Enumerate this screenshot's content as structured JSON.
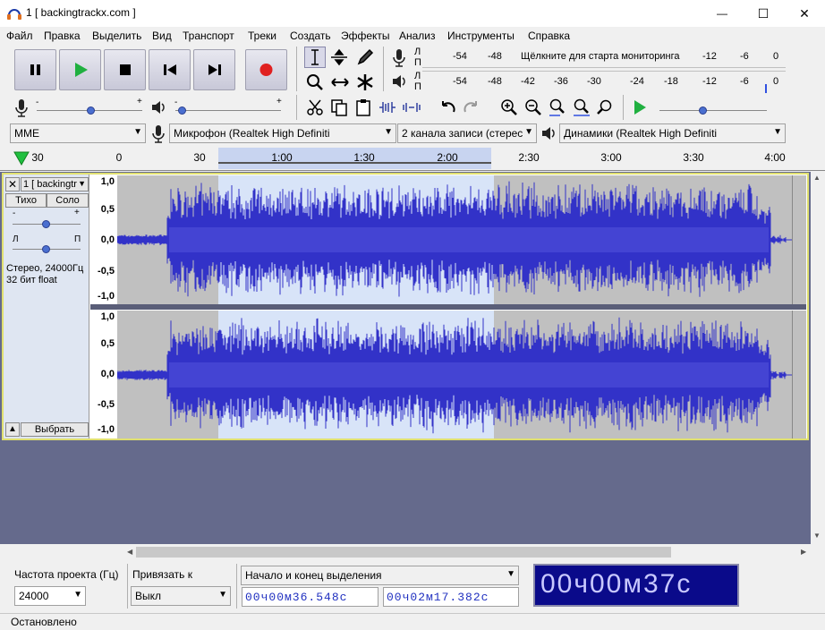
{
  "window": {
    "title": "1 [ backingtrackx.com ]",
    "minimize": "—",
    "maximize": "☐",
    "close": "✕"
  },
  "menu": [
    "Файл",
    "Правка",
    "Выделить",
    "Вид",
    "Транспорт",
    "Треки",
    "Создать",
    "Эффекты",
    "Анализ",
    "Инструменты",
    "Справка"
  ],
  "meter": {
    "record_channels": [
      "Л",
      "П"
    ],
    "play_channels": [
      "Л",
      "П"
    ],
    "record_ticks": [
      "-54",
      "-48",
      "-12",
      "-6",
      "0"
    ],
    "record_hint": "Щёлкните для старта мониторинга",
    "play_ticks": [
      "-54",
      "-48",
      "-42",
      "-36",
      "-30",
      "-24",
      "-18",
      "-12",
      "-6",
      "0"
    ]
  },
  "mixer": {
    "rec_slider": [
      "-",
      "+"
    ],
    "play_slider": [
      "-",
      "+"
    ]
  },
  "devices": {
    "host": "MME",
    "mic": "Микрофон (Realtek High Definiti",
    "channels": "2  канала записи (стерес",
    "speaker": "Динамики (Realtek High Definiti"
  },
  "ruler": {
    "labels": [
      "30",
      "0",
      "30",
      "1:00",
      "1:30",
      "2:00",
      "2:30",
      "3:00",
      "3:30",
      "4:00"
    ]
  },
  "track": {
    "name": "1 [ backingtr",
    "mute": "Тихо",
    "solo": "Соло",
    "gain": [
      "-",
      "+"
    ],
    "pan": [
      "Л",
      "П"
    ],
    "info1": "Стерео, 24000Гц",
    "info2": "32 бит float",
    "select": "Выбрать",
    "scale": [
      "1,0",
      "0,5",
      "0,0",
      "-0,5",
      "-1,0"
    ]
  },
  "bottom": {
    "rate_label": "Частота проекта (Гц)",
    "rate_value": "24000",
    "snap_label": "Привязать к",
    "snap_value": "Выкл",
    "sel_mode": "Начало и конец выделения",
    "sel_start": "00ч00м36.548с",
    "sel_end": "00ч02м17.382с",
    "position": "00ч00м37с"
  },
  "status": "Остановлено"
}
